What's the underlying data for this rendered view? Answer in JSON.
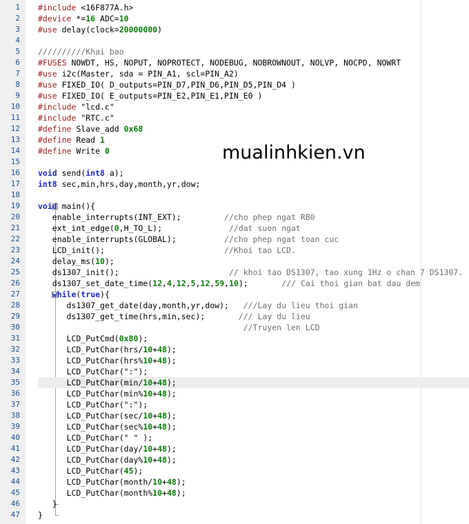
{
  "editor": {
    "watermark": "mualinhkien.vn",
    "current_line": 35,
    "fold_markers": [
      {
        "line": 19,
        "symbol": "−"
      },
      {
        "line": 27,
        "symbol": "−"
      }
    ],
    "lines": [
      [
        [
          "pp",
          "#include"
        ],
        [
          "t",
          " <16F877A.h>"
        ]
      ],
      [
        [
          "pp",
          "#device"
        ],
        [
          "t",
          " *="
        ],
        [
          "num",
          "16"
        ],
        [
          "t",
          " ADC="
        ],
        [
          "num",
          "10"
        ]
      ],
      [
        [
          "pp",
          "#use"
        ],
        [
          "t",
          " delay(clock="
        ],
        [
          "num",
          "20000000"
        ],
        [
          "t",
          ")"
        ]
      ],
      [],
      [
        [
          "cm",
          "//////////Khai bao"
        ]
      ],
      [
        [
          "pp",
          "#FUSES"
        ],
        [
          "t",
          " NOWDT, HS, NOPUT, NOPROTECT, NODEBUG, NOBROWNOUT, NOLVP, NOCPD, NOWRT"
        ]
      ],
      [
        [
          "pp",
          "#use"
        ],
        [
          "t",
          " i2c(Master, sda = PIN_A1, scl=PIN_A2)"
        ]
      ],
      [
        [
          "pp",
          "#use"
        ],
        [
          "t",
          " FIXED_IO( D_outputs=PIN_D7,PIN_D6,PIN_D5,PIN_D4 )"
        ]
      ],
      [
        [
          "pp",
          "#use"
        ],
        [
          "t",
          " FIXED_IO( E_outputs=PIN_E2,PIN_E1,PIN_E0 )"
        ]
      ],
      [
        [
          "pp",
          "#include"
        ],
        [
          "t",
          " \"lcd.c\""
        ]
      ],
      [
        [
          "pp",
          "#include"
        ],
        [
          "t",
          " \"RTC.c\""
        ]
      ],
      [
        [
          "pp",
          "#define"
        ],
        [
          "t",
          " Slave_add "
        ],
        [
          "num",
          "0x68"
        ]
      ],
      [
        [
          "pp",
          "#define"
        ],
        [
          "t",
          " Read "
        ],
        [
          "num",
          "1"
        ]
      ],
      [
        [
          "pp",
          "#define"
        ],
        [
          "t",
          " Write "
        ],
        [
          "num",
          "0"
        ]
      ],
      [],
      [
        [
          "kw",
          "void"
        ],
        [
          "t",
          " send("
        ],
        [
          "kw",
          "int8"
        ],
        [
          "t",
          " a);"
        ]
      ],
      [
        [
          "kw",
          "int8"
        ],
        [
          "t",
          " sec,min,hrs,day,month,yr,dow;"
        ]
      ],
      [],
      [
        [
          "kw",
          "void"
        ],
        [
          "t",
          " main(){"
        ]
      ],
      [
        [
          "t",
          "   enable_interrupts(INT_EXT);         "
        ],
        [
          "cm",
          "//cho phep ngat RB0"
        ]
      ],
      [
        [
          "t",
          "   ext_int_edge("
        ],
        [
          "num",
          "0"
        ],
        [
          "t",
          ",H_TO_L);              "
        ],
        [
          "cm",
          "//dat suon ngat"
        ]
      ],
      [
        [
          "t",
          "   enable_interrupts(GLOBAL);          "
        ],
        [
          "cm",
          "//cho phep ngat toan cuc"
        ]
      ],
      [
        [
          "t",
          "   LCD_init();                         "
        ],
        [
          "cm",
          "//Khoi tao LCD."
        ]
      ],
      [
        [
          "t",
          "   delay_ms("
        ],
        [
          "num",
          "10"
        ],
        [
          "t",
          ");"
        ]
      ],
      [
        [
          "t",
          "   ds1307_init();                       "
        ],
        [
          "cm",
          "// khoi tao DS1307, tao xung 1Hz o chan 7 DS1307."
        ]
      ],
      [
        [
          "t",
          "   ds1307_set_date_time("
        ],
        [
          "num",
          "12"
        ],
        [
          "t",
          ","
        ],
        [
          "num",
          "4"
        ],
        [
          "t",
          ","
        ],
        [
          "num",
          "12"
        ],
        [
          "t",
          ","
        ],
        [
          "num",
          "5"
        ],
        [
          "t",
          ","
        ],
        [
          "num",
          "12"
        ],
        [
          "t",
          ","
        ],
        [
          "num",
          "59"
        ],
        [
          "t",
          ","
        ],
        [
          "num",
          "10"
        ],
        [
          "t",
          ");       "
        ],
        [
          "cm",
          "/// Cai thoi gian bat dau dem"
        ]
      ],
      [
        [
          "t",
          "   "
        ],
        [
          "kw",
          "while"
        ],
        [
          "t",
          "("
        ],
        [
          "kw",
          "true"
        ],
        [
          "t",
          "){"
        ]
      ],
      [
        [
          "t",
          "      ds1307_get_date(day,month,yr,dow);   "
        ],
        [
          "cm",
          "///Lay du lieu thoi gian"
        ]
      ],
      [
        [
          "t",
          "      ds1307_get_time(hrs,min,sec);       "
        ],
        [
          "cm",
          "/// Lay du lieu"
        ]
      ],
      [
        [
          "t",
          "                                           "
        ],
        [
          "cm",
          "//Truyen len LCD"
        ]
      ],
      [
        [
          "t",
          "      LCD_PutCmd("
        ],
        [
          "num",
          "0x80"
        ],
        [
          "t",
          ");"
        ]
      ],
      [
        [
          "t",
          "      LCD_PutChar(hrs/"
        ],
        [
          "num",
          "10"
        ],
        [
          "t",
          "+"
        ],
        [
          "num",
          "48"
        ],
        [
          "t",
          ");"
        ]
      ],
      [
        [
          "t",
          "      LCD_PutChar(hrs%"
        ],
        [
          "num",
          "10"
        ],
        [
          "t",
          "+"
        ],
        [
          "num",
          "48"
        ],
        [
          "t",
          ");"
        ]
      ],
      [
        [
          "t",
          "      LCD_PutChar(\":\");"
        ]
      ],
      [
        [
          "t",
          "      LCD_PutChar(min/"
        ],
        [
          "num",
          "10"
        ],
        [
          "t",
          "+"
        ],
        [
          "num",
          "48"
        ],
        [
          "t",
          ");"
        ]
      ],
      [
        [
          "t",
          "      LCD_PutChar(min%"
        ],
        [
          "num",
          "10"
        ],
        [
          "t",
          "+"
        ],
        [
          "num",
          "48"
        ],
        [
          "t",
          ");"
        ]
      ],
      [
        [
          "t",
          "      LCD_PutChar(\":\");"
        ]
      ],
      [
        [
          "t",
          "      LCD_PutChar(sec/"
        ],
        [
          "num",
          "10"
        ],
        [
          "t",
          "+"
        ],
        [
          "num",
          "48"
        ],
        [
          "t",
          ");"
        ]
      ],
      [
        [
          "t",
          "      LCD_PutChar(sec%"
        ],
        [
          "num",
          "10"
        ],
        [
          "t",
          "+"
        ],
        [
          "num",
          "48"
        ],
        [
          "t",
          ");"
        ]
      ],
      [
        [
          "t",
          "      LCD_PutChar(\" \" );"
        ]
      ],
      [
        [
          "t",
          "      LCD_PutChar(day/"
        ],
        [
          "num",
          "10"
        ],
        [
          "t",
          "+"
        ],
        [
          "num",
          "48"
        ],
        [
          "t",
          ");"
        ]
      ],
      [
        [
          "t",
          "      LCD_PutChar(day%"
        ],
        [
          "num",
          "10"
        ],
        [
          "t",
          "+"
        ],
        [
          "num",
          "48"
        ],
        [
          "t",
          ");"
        ]
      ],
      [
        [
          "t",
          "      LCD_PutChar("
        ],
        [
          "num",
          "45"
        ],
        [
          "t",
          ");"
        ]
      ],
      [
        [
          "t",
          "      LCD_PutChar(month/"
        ],
        [
          "num",
          "10"
        ],
        [
          "t",
          "+"
        ],
        [
          "num",
          "48"
        ],
        [
          "t",
          ");"
        ]
      ],
      [
        [
          "t",
          "      LCD_PutChar(month%"
        ],
        [
          "num",
          "10"
        ],
        [
          "t",
          "+"
        ],
        [
          "num",
          "48"
        ],
        [
          "t",
          ");"
        ]
      ],
      [
        [
          "t",
          "   }"
        ]
      ],
      [
        [
          "t",
          "}"
        ]
      ]
    ]
  }
}
